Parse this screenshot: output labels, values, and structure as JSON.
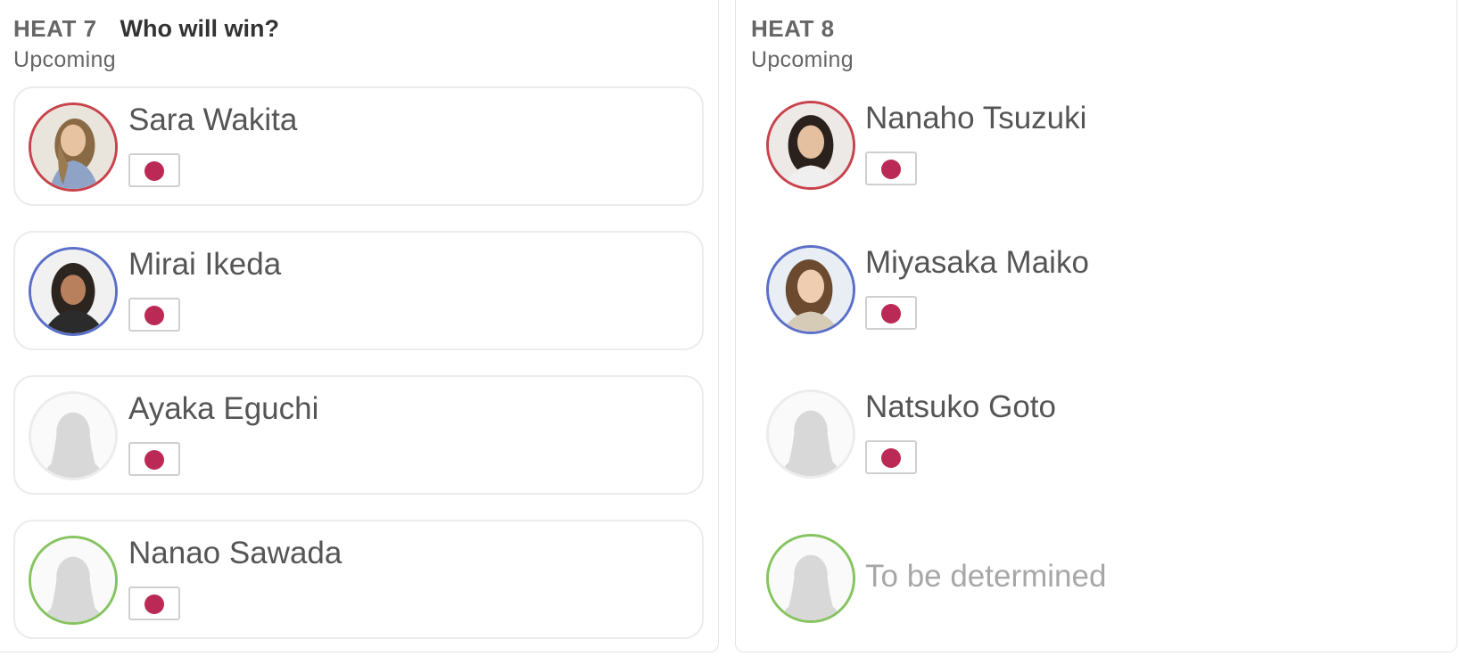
{
  "heats": [
    {
      "label": "HEAT 7",
      "cta": "Who will win?",
      "status": "Upcoming",
      "athletes": [
        {
          "name": "Sara Wakita",
          "color": "#c8434c",
          "photo": "photo",
          "flag": "japan-flag-icon"
        },
        {
          "name": "Mirai Ikeda",
          "color": "#5b6fc9",
          "photo": "photo",
          "flag": "japan-flag-icon"
        },
        {
          "name": "Ayaka Eguchi",
          "color": "#ececec",
          "photo": "placeholder-silhouette",
          "flag": "japan-flag-icon"
        },
        {
          "name": "Nanao Sawada",
          "color": "#86c460",
          "photo": "placeholder-silhouette",
          "flag": "japan-flag-icon"
        }
      ]
    },
    {
      "label": "HEAT 8",
      "cta": "",
      "status": "Upcoming",
      "athletes": [
        {
          "name": "Nanaho Tsuzuki",
          "color": "#c8434c",
          "photo": "photo",
          "flag": "japan-flag-icon"
        },
        {
          "name": "Miyasaka Maiko",
          "color": "#5b6fc9",
          "photo": "photo",
          "flag": "japan-flag-icon"
        },
        {
          "name": "Natsuko Goto",
          "color": "#ececec",
          "photo": "placeholder-silhouette",
          "flag": "japan-flag-icon"
        },
        {
          "name": "To be determined",
          "color": "#86c460",
          "photo": "placeholder-silhouette",
          "flag": ""
        }
      ]
    }
  ],
  "colors": {
    "red_jersey": "#c8434c",
    "blue_jersey": "#5b6fc9",
    "green_jersey": "#86c460",
    "flag_sun": "#bb2a56"
  }
}
